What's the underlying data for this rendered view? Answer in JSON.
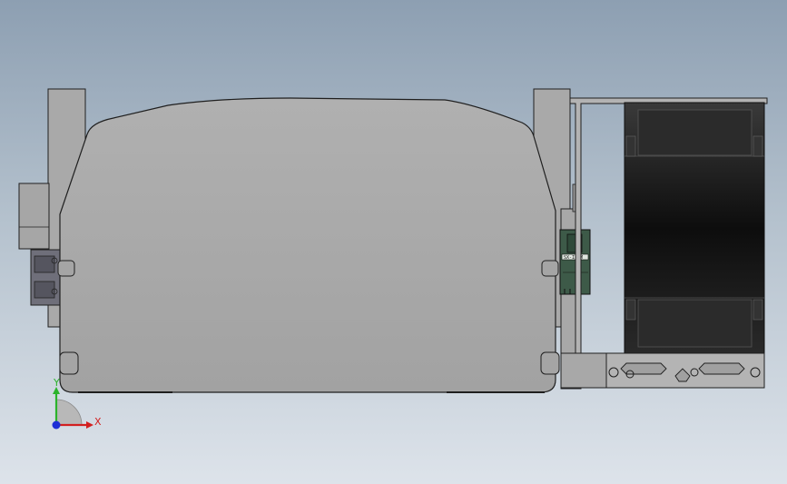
{
  "viewport": {
    "background_top": "#8d9fb2",
    "background_bottom": "#dde3ea"
  },
  "model": {
    "body_color": "#a8a8a8",
    "edge_color": "#1f1f1f",
    "sensor_color": "#3d5a48",
    "sensor_label": "SX-I-SM",
    "roller_color": "#1a1a1a"
  },
  "triad": {
    "x_label": "X",
    "y_label": "Y",
    "x_color": "#d22020",
    "y_color": "#2bb32b",
    "z_color": "#1e2fd6"
  }
}
